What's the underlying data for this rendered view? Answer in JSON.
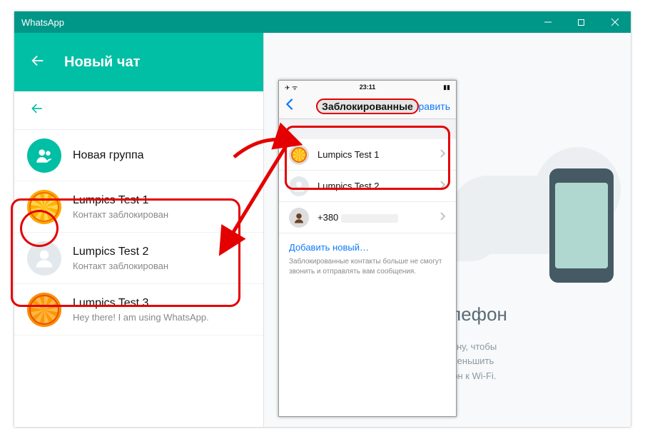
{
  "window": {
    "title": "WhatsApp"
  },
  "left": {
    "header_title": "Новый чат",
    "new_group": "Новая группа",
    "contacts": [
      {
        "name": "Lumpics Test 1",
        "status": "Контакт заблокирован"
      },
      {
        "name": "Lumpics Test 2",
        "status": "Контакт заблокирован"
      },
      {
        "name": "Lumpics Test 3",
        "status": "Hey there! I am using WhatsApp."
      }
    ]
  },
  "right_bg": {
    "title": "свой телефон",
    "line1": "шему телефону, чтобы",
    "line2": "ия. Чтобы уменьшить",
    "line3": "очите телефон к Wi-Fi."
  },
  "iphone": {
    "status_time": "23:11",
    "nav_title": "Заблокированные",
    "nav_edit": "Править",
    "rows": [
      {
        "name": "Lumpics Test 1"
      },
      {
        "name": "Lumpics Test 2"
      },
      {
        "name": "+380"
      }
    ],
    "add_new": "Добавить новый…",
    "description": "Заблокированные контакты больше не смогут звонить и отправлять вам сообщения."
  }
}
